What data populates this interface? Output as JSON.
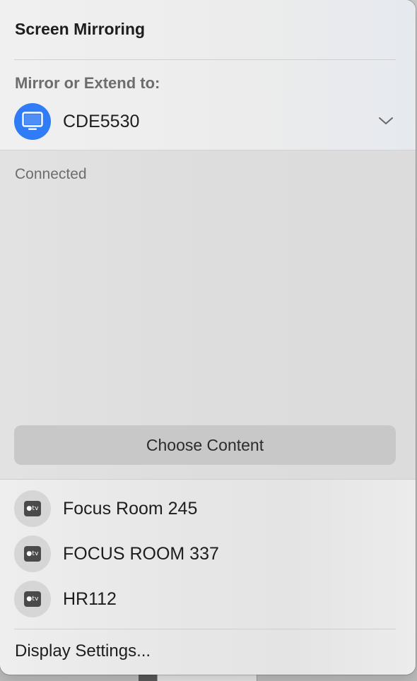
{
  "panel": {
    "title": "Screen Mirroring",
    "section_label": "Mirror or Extend to:",
    "selected_device": {
      "name": "CDE5530",
      "icon": "display-icon",
      "status": "Connected"
    },
    "choose_content_label": "Choose Content",
    "available_devices": [
      {
        "name": "Focus Room 245",
        "icon": "apple-tv-icon"
      },
      {
        "name": "FOCUS ROOM 337",
        "icon": "apple-tv-icon"
      },
      {
        "name": "HR112",
        "icon": "apple-tv-icon"
      }
    ],
    "apple_tv_badge": "tv",
    "footer_link": "Display Settings..."
  },
  "colors": {
    "accent": "#2f7cf6",
    "button_bg": "#c8c8c8"
  }
}
